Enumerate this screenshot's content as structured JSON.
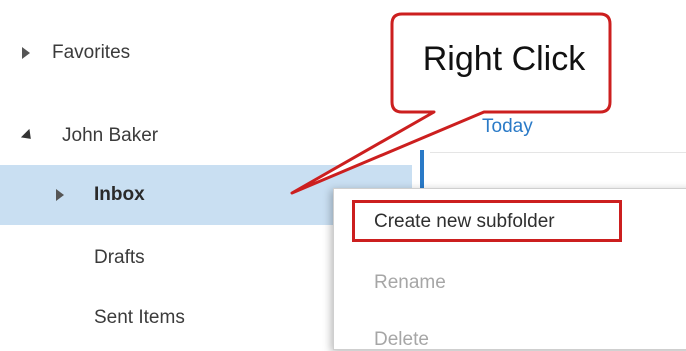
{
  "folder_pane": {
    "favorites_label": "Favorites",
    "account_name": "John Baker",
    "inbox_label": "Inbox",
    "drafts_label": "Drafts",
    "sent_label": "Sent Items"
  },
  "message_list": {
    "group_heading": "Today"
  },
  "context_menu": {
    "items": [
      {
        "label": "Create new subfolder",
        "enabled": true
      },
      {
        "label": "Rename",
        "enabled": false
      },
      {
        "label": "Delete",
        "enabled": false
      }
    ]
  },
  "annotation": {
    "callout_text": "Right Click",
    "callout_color": "#cc1f1f",
    "highlight_color": "#cc1f1f"
  },
  "colors": {
    "selection_bg": "#c9dff2",
    "accent_blue": "#2a7ac7"
  },
  "icons": {
    "expand": "caret-right-icon",
    "collapse": "caret-down-icon"
  }
}
